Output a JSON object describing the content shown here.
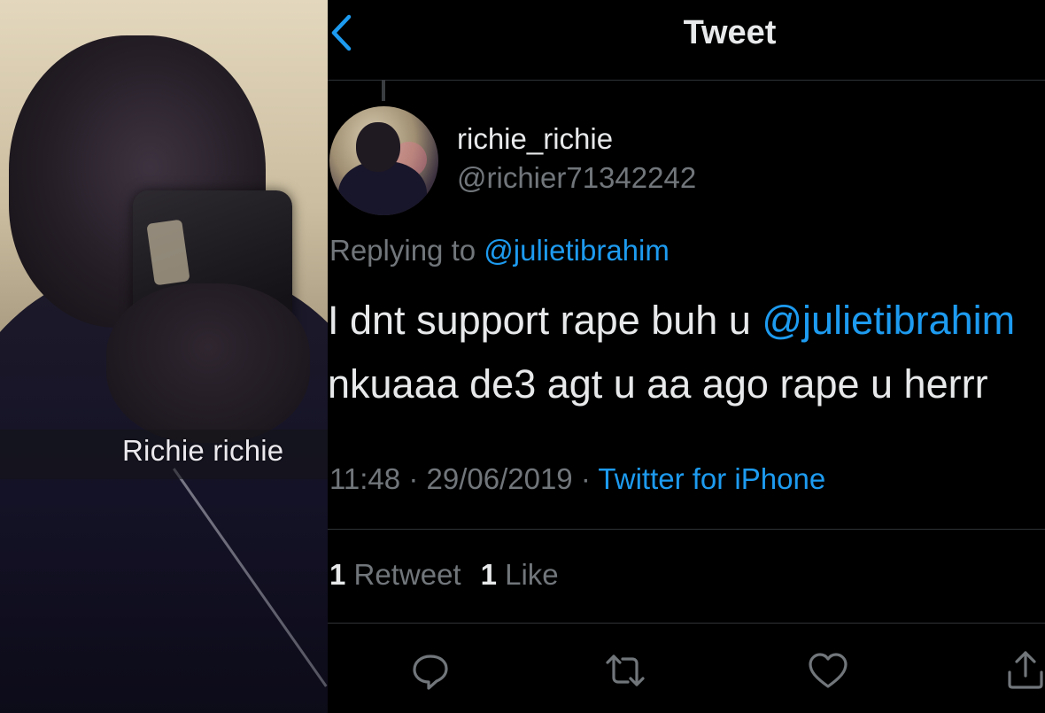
{
  "photo": {
    "caption": "Richie richie"
  },
  "header": {
    "title": "Tweet",
    "back_icon": "chevron-left-icon"
  },
  "tweet": {
    "display_name": "richie_richie",
    "handle": "@richier71342242",
    "replying_prefix": "Replying to",
    "replying_to": "@julietibrahim",
    "text_line1_before": "I dnt support rape buh u",
    "text_line1_mention": "@julietibrahim",
    "text_line2": "nkuaaa de3 agt u aa ago rape u herrr",
    "time": "11:48",
    "date": "29/06/2019",
    "separator": "·",
    "source": "Twitter for iPhone",
    "retweet_count": "1",
    "retweet_label": "Retweet",
    "like_count": "1",
    "like_label": "Like"
  },
  "actions": {
    "reply_icon": "reply-icon",
    "retweet_icon": "retweet-icon",
    "like_icon": "heart-icon",
    "share_icon": "share-icon"
  },
  "colors": {
    "background": "#000000",
    "accent_blue": "#1d9bf0",
    "secondary_text": "#71767b",
    "primary_text": "#e7e9ea",
    "divider": "#2f3336"
  }
}
